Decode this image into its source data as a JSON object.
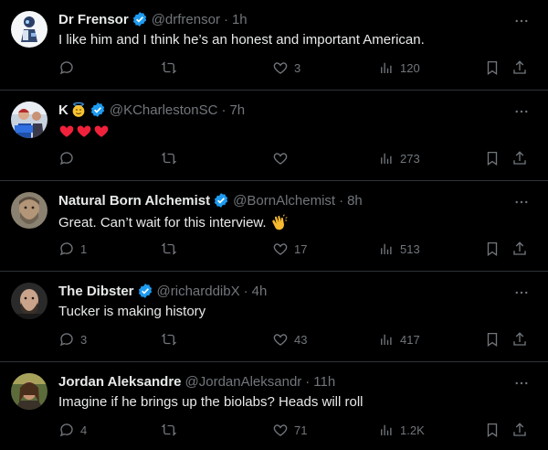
{
  "tweets": [
    {
      "name": "Dr Frensor",
      "verified": true,
      "handle": "@drfrensor",
      "time": "1h",
      "text": "I like him and I think he’s an honest and important American.",
      "replies": "",
      "retweets": "",
      "likes": "3",
      "views": "120",
      "avatar": "robot-figure-on-white"
    },
    {
      "name": "K",
      "name_emoji": "smiling-face-with-halo",
      "verified": true,
      "handle": "@KCharlestonSC",
      "time": "7h",
      "text": "❤️❤️❤️",
      "text_glyphs": [
        "red-heart",
        "red-heart",
        "red-heart"
      ],
      "replies": "",
      "retweets": "",
      "likes": "",
      "views": "273",
      "avatar": "people-with-blue-sign"
    },
    {
      "name": "Natural Born Alchemist",
      "verified": true,
      "handle": "@BornAlchemist",
      "time": "8h",
      "text": "Great. Can’t wait for this interview.",
      "text_emoji": "clapping-hands",
      "replies": "1",
      "retweets": "",
      "likes": "17",
      "views": "513",
      "avatar": "bearded-man-photo"
    },
    {
      "name": "The Dibster",
      "verified": true,
      "handle": "@richarddibX",
      "time": "4h",
      "text": "Tucker is making history",
      "replies": "3",
      "retweets": "",
      "likes": "43",
      "views": "417",
      "avatar": "bald-bearded-man-photo"
    },
    {
      "name": "Jordan Aleksandre",
      "verified": false,
      "handle": "@JordanAleksandr",
      "time": "11h",
      "text": "Imagine if he brings up the biolabs? Heads will roll",
      "replies": "4",
      "retweets": "",
      "likes": "71",
      "views": "1.2K",
      "avatar": "man-with-long-hair-photo"
    }
  ],
  "colors": {
    "background": "#000000",
    "text_primary": "#e7e9ea",
    "text_secondary": "#71767b",
    "verified_badge": "#1d9bf0",
    "divider": "#2f3336"
  },
  "icons": {
    "reply": "reply-icon",
    "retweet": "retweet-icon",
    "like": "heart-icon",
    "views": "analytics-icon",
    "bookmark": "bookmark-icon",
    "share": "share-icon",
    "more": "more-icon",
    "verified": "verified-badge-icon"
  }
}
